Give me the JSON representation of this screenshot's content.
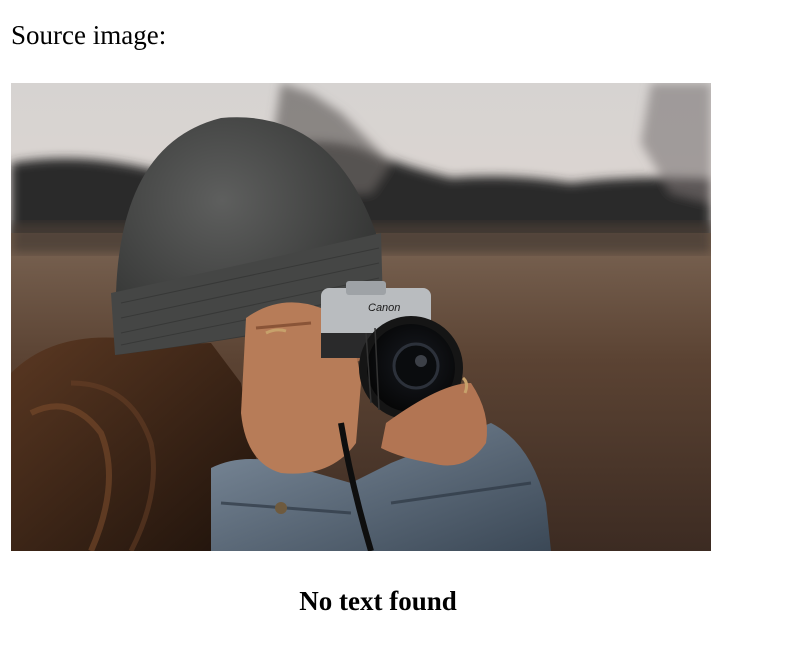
{
  "page": {
    "heading": "Source image:",
    "result_text": "No text found"
  },
  "photo": {
    "subject": "person-photographing-with-film-camera",
    "camera_brand": "Canon",
    "colors": {
      "sky": "#d9d5d2",
      "field": "#5e4634",
      "beanie": "#4b4c4b",
      "skin": "#b77c58",
      "denim": "#5d6b7a",
      "camera_body": "#b9bcbf",
      "lens": "#141414"
    }
  }
}
